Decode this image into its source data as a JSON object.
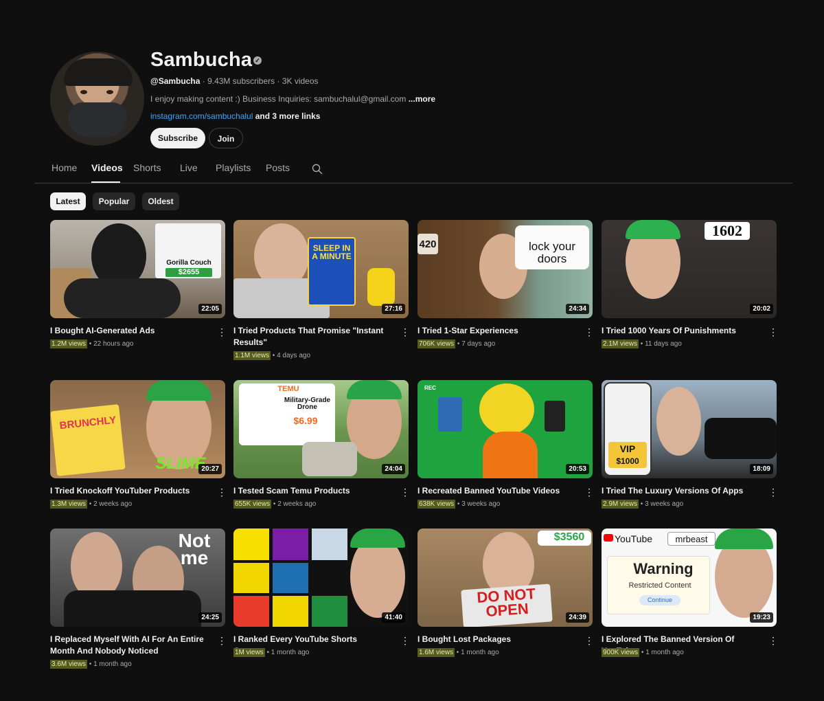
{
  "channel": {
    "name": "Sambucha",
    "handle": "@Sambucha",
    "subscribers": "9.43M subscribers",
    "video_count": "3K videos",
    "description": "I enjoy making content :) Business Inquiries: sambuchalul@gmail.com",
    "description_more": "...more",
    "link": "instagram.com/sambuchalul",
    "more_links": "and 3 more links",
    "subscribe_label": "Subscribe",
    "join_label": "Join"
  },
  "tabs": [
    "Home",
    "Videos",
    "Shorts",
    "Live",
    "Playlists",
    "Posts"
  ],
  "active_tab": "Videos",
  "chips": [
    "Latest",
    "Popular",
    "Oldest"
  ],
  "active_chip": "Latest",
  "videos": [
    {
      "title": "I Bought AI-Generated Ads",
      "views": "1.2M views",
      "age": "22 hours ago",
      "duration": "22:05",
      "overlay": "Gorilla Couch",
      "overlay2": "$2655"
    },
    {
      "title": "I Tried Products That Promise \"Instant Results\"",
      "views": "1.1M views",
      "age": "4 days ago",
      "duration": "27:16",
      "overlay": "SLEEP IN A MINUTE"
    },
    {
      "title": "I Tried 1-Star Experiences",
      "views": "706K views",
      "age": "7 days ago",
      "duration": "24:34",
      "overlay": "lock your doors",
      "overlay2": "420"
    },
    {
      "title": "I Tried 1000 Years Of Punishments",
      "views": "2.1M views",
      "age": "11 days ago",
      "duration": "20:02",
      "overlay": "1602"
    },
    {
      "title": "I Tried Knockoff YouTuber Products",
      "views": "1.3M views",
      "age": "2 weeks ago",
      "duration": "20:27",
      "overlay": "BRUNCHLY",
      "overlay2": "SLIME"
    },
    {
      "title": "I Tested Scam Temu Products",
      "views": "655K views",
      "age": "2 weeks ago",
      "duration": "24:04",
      "overlay": "TEMU",
      "overlay2": "Military-Grade Drone",
      "overlay3": "$6.99"
    },
    {
      "title": "I Recreated Banned YouTube Videos",
      "views": "638K views",
      "age": "3 weeks ago",
      "duration": "20:53",
      "overlay": "REC"
    },
    {
      "title": "I Tried The Luxury Versions Of Apps",
      "views": "2.9M views",
      "age": "3 weeks ago",
      "duration": "18:09",
      "overlay": "VIP",
      "overlay2": "$1000"
    },
    {
      "title": "I Replaced Myself With AI For An Entire Month And Nobody Noticed",
      "views": "3.6M views",
      "age": "1 month ago",
      "duration": "24:25",
      "overlay": "Not me"
    },
    {
      "title": "I Ranked Every YouTube Shorts Creator",
      "views": "1M views",
      "age": "1 month ago",
      "duration": "41:40"
    },
    {
      "title": "I Bought Lost Packages",
      "views": "1.6M views",
      "age": "1 month ago",
      "duration": "24:39",
      "overlay": "$3560",
      "overlay2": "DO NOT OPEN"
    },
    {
      "title": "I Explored The Banned Version Of YouTube",
      "views": "900K views",
      "age": "1 month ago",
      "duration": "19:23",
      "overlay": "Warning",
      "overlay2": "Restricted Content",
      "overlay3": "Continue",
      "overlay4": "mrbeast"
    }
  ],
  "colors": {
    "accent_link": "#3ea6ff",
    "background": "#0f0f0f",
    "views_highlight": "#555a1e"
  }
}
